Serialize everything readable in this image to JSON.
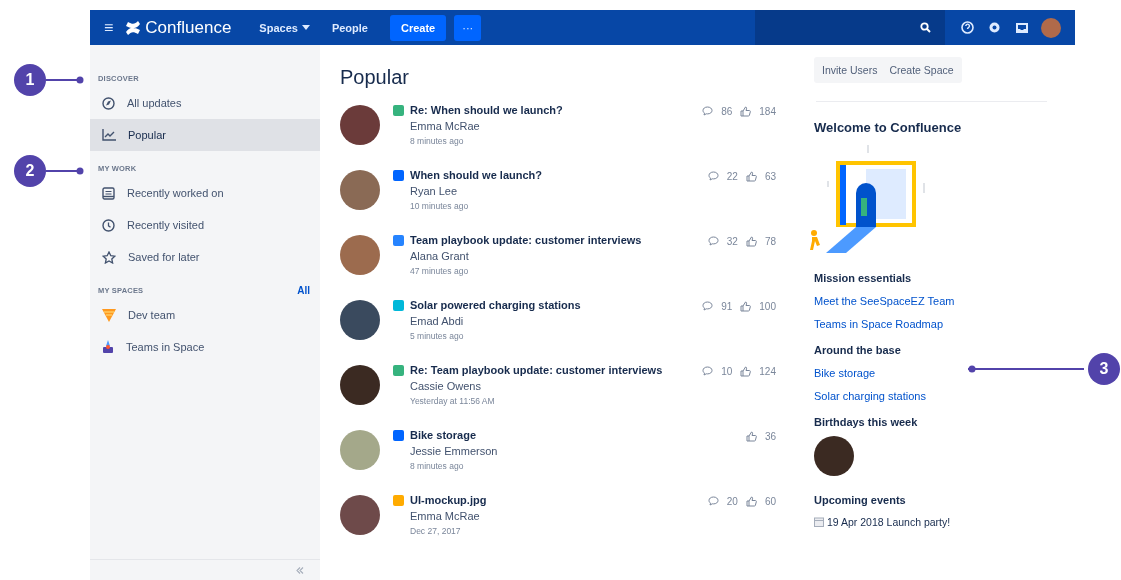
{
  "nav": {
    "logo": "Confluence",
    "menu_icon": "≡",
    "items": [
      {
        "label": "Spaces",
        "dropdown": true
      },
      {
        "label": "People",
        "dropdown": false
      }
    ],
    "create": "Create",
    "more": "···"
  },
  "sidebar": {
    "sections": [
      {
        "title": "DISCOVER",
        "items": [
          {
            "label": "All updates",
            "selected": false
          },
          {
            "label": "Popular",
            "selected": true
          }
        ]
      },
      {
        "title": "MY WORK",
        "items": [
          {
            "label": "Recently worked on",
            "selected": false
          },
          {
            "label": "Recently visited",
            "selected": false
          },
          {
            "label": "Saved for later",
            "selected": false
          }
        ]
      },
      {
        "title": "MY SPACES",
        "link": "All",
        "items": [
          {
            "label": "Dev team",
            "selected": false
          },
          {
            "label": "Teams in Space",
            "selected": false
          }
        ]
      }
    ]
  },
  "feed": {
    "title": "Popular",
    "items": [
      {
        "title": "Re: When should we launch?",
        "author": "Emma McRae",
        "time": "8 minutes ago",
        "comments": "86",
        "likes": "184",
        "color": "#36b37e"
      },
      {
        "title": "When should we launch?",
        "author": "Ryan Lee",
        "time": "10 minutes ago",
        "comments": "22",
        "likes": "63",
        "color": "#0065ff"
      },
      {
        "title": "Team playbook update: customer interviews",
        "author": "Alana Grant",
        "time": "47 minutes ago",
        "comments": "32",
        "likes": "78",
        "color": "#2684ff"
      },
      {
        "title": "Solar powered charging stations",
        "author": "Emad Abdi",
        "time": "5 minutes ago",
        "comments": "91",
        "likes": "100",
        "color": "#00b8d9"
      },
      {
        "title": "Re: Team playbook update: customer interviews",
        "author": "Cassie Owens",
        "time": "Yesterday at 11:56 AM",
        "comments": "10",
        "likes": "124",
        "color": "#36b37e"
      },
      {
        "title": "Bike storage",
        "author": "Jessie Emmerson",
        "time": "8 minutes ago",
        "likes": "36",
        "color": "#0065ff"
      },
      {
        "title": "UI-mockup.jpg",
        "author": "Emma McRae",
        "time": "Dec 27, 2017",
        "comments": "20",
        "likes": "60",
        "color": "#ffab00"
      }
    ]
  },
  "aside": {
    "buttons": [
      "Invite Users",
      "Create Space"
    ],
    "welcome": "Welcome to Confluence",
    "groups": [
      {
        "title": "Mission essentials",
        "links": [
          "Meet the SeeSpaceEZ Team",
          "Teams in Space Roadmap"
        ]
      },
      {
        "title": "Around the base",
        "links": [
          "Bike storage",
          "Solar charging stations"
        ]
      }
    ],
    "birthdays": "Birthdays this week",
    "events_title": "Upcoming events",
    "events": [
      "19 Apr 2018 Launch party!"
    ]
  },
  "callouts": [
    {
      "label": "1"
    },
    {
      "label": "2"
    },
    {
      "label": "3"
    }
  ]
}
